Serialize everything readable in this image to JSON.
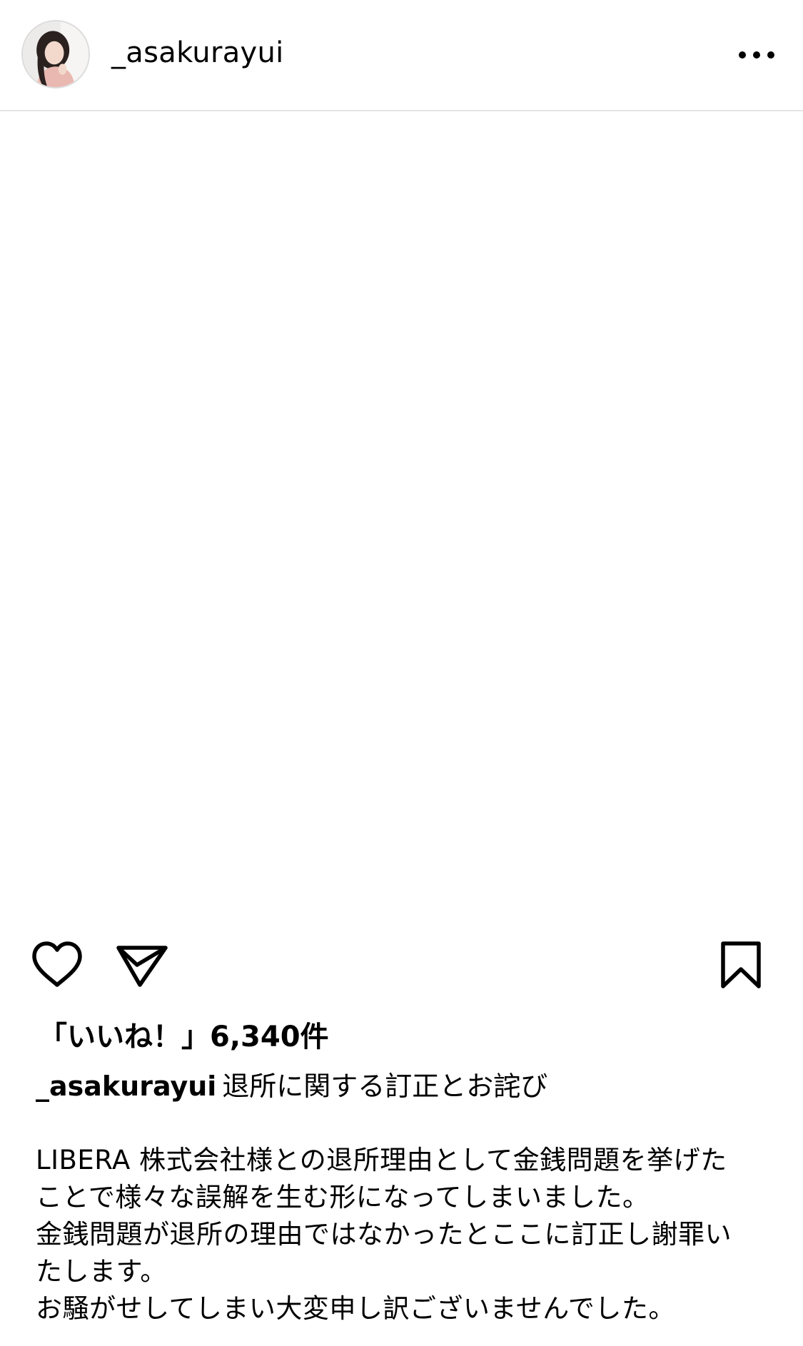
{
  "post": {
    "username": "_asakurayui",
    "likes_text": "「いいね！」6,340件",
    "caption_title": "退所に関する訂正とお詫び",
    "caption_lines": [
      "LIBERA 株式会社様との退所理由として金銭問題を挙げた",
      "ことで様々な誤解を生む形になってしまいました。",
      "金銭問題が退所の理由ではなかったとここに訂正し謝罪い",
      "たします。",
      "お騒がせしてしまい大変申し訳ございませんでした。"
    ]
  },
  "icons": {
    "avatar": "avatar",
    "more": "more-dots-icon",
    "like": "heart-icon",
    "share": "send-icon",
    "save": "bookmark-icon"
  },
  "colors": {
    "text": "#000000",
    "divider": "#e4e4e4",
    "background": "#ffffff"
  }
}
